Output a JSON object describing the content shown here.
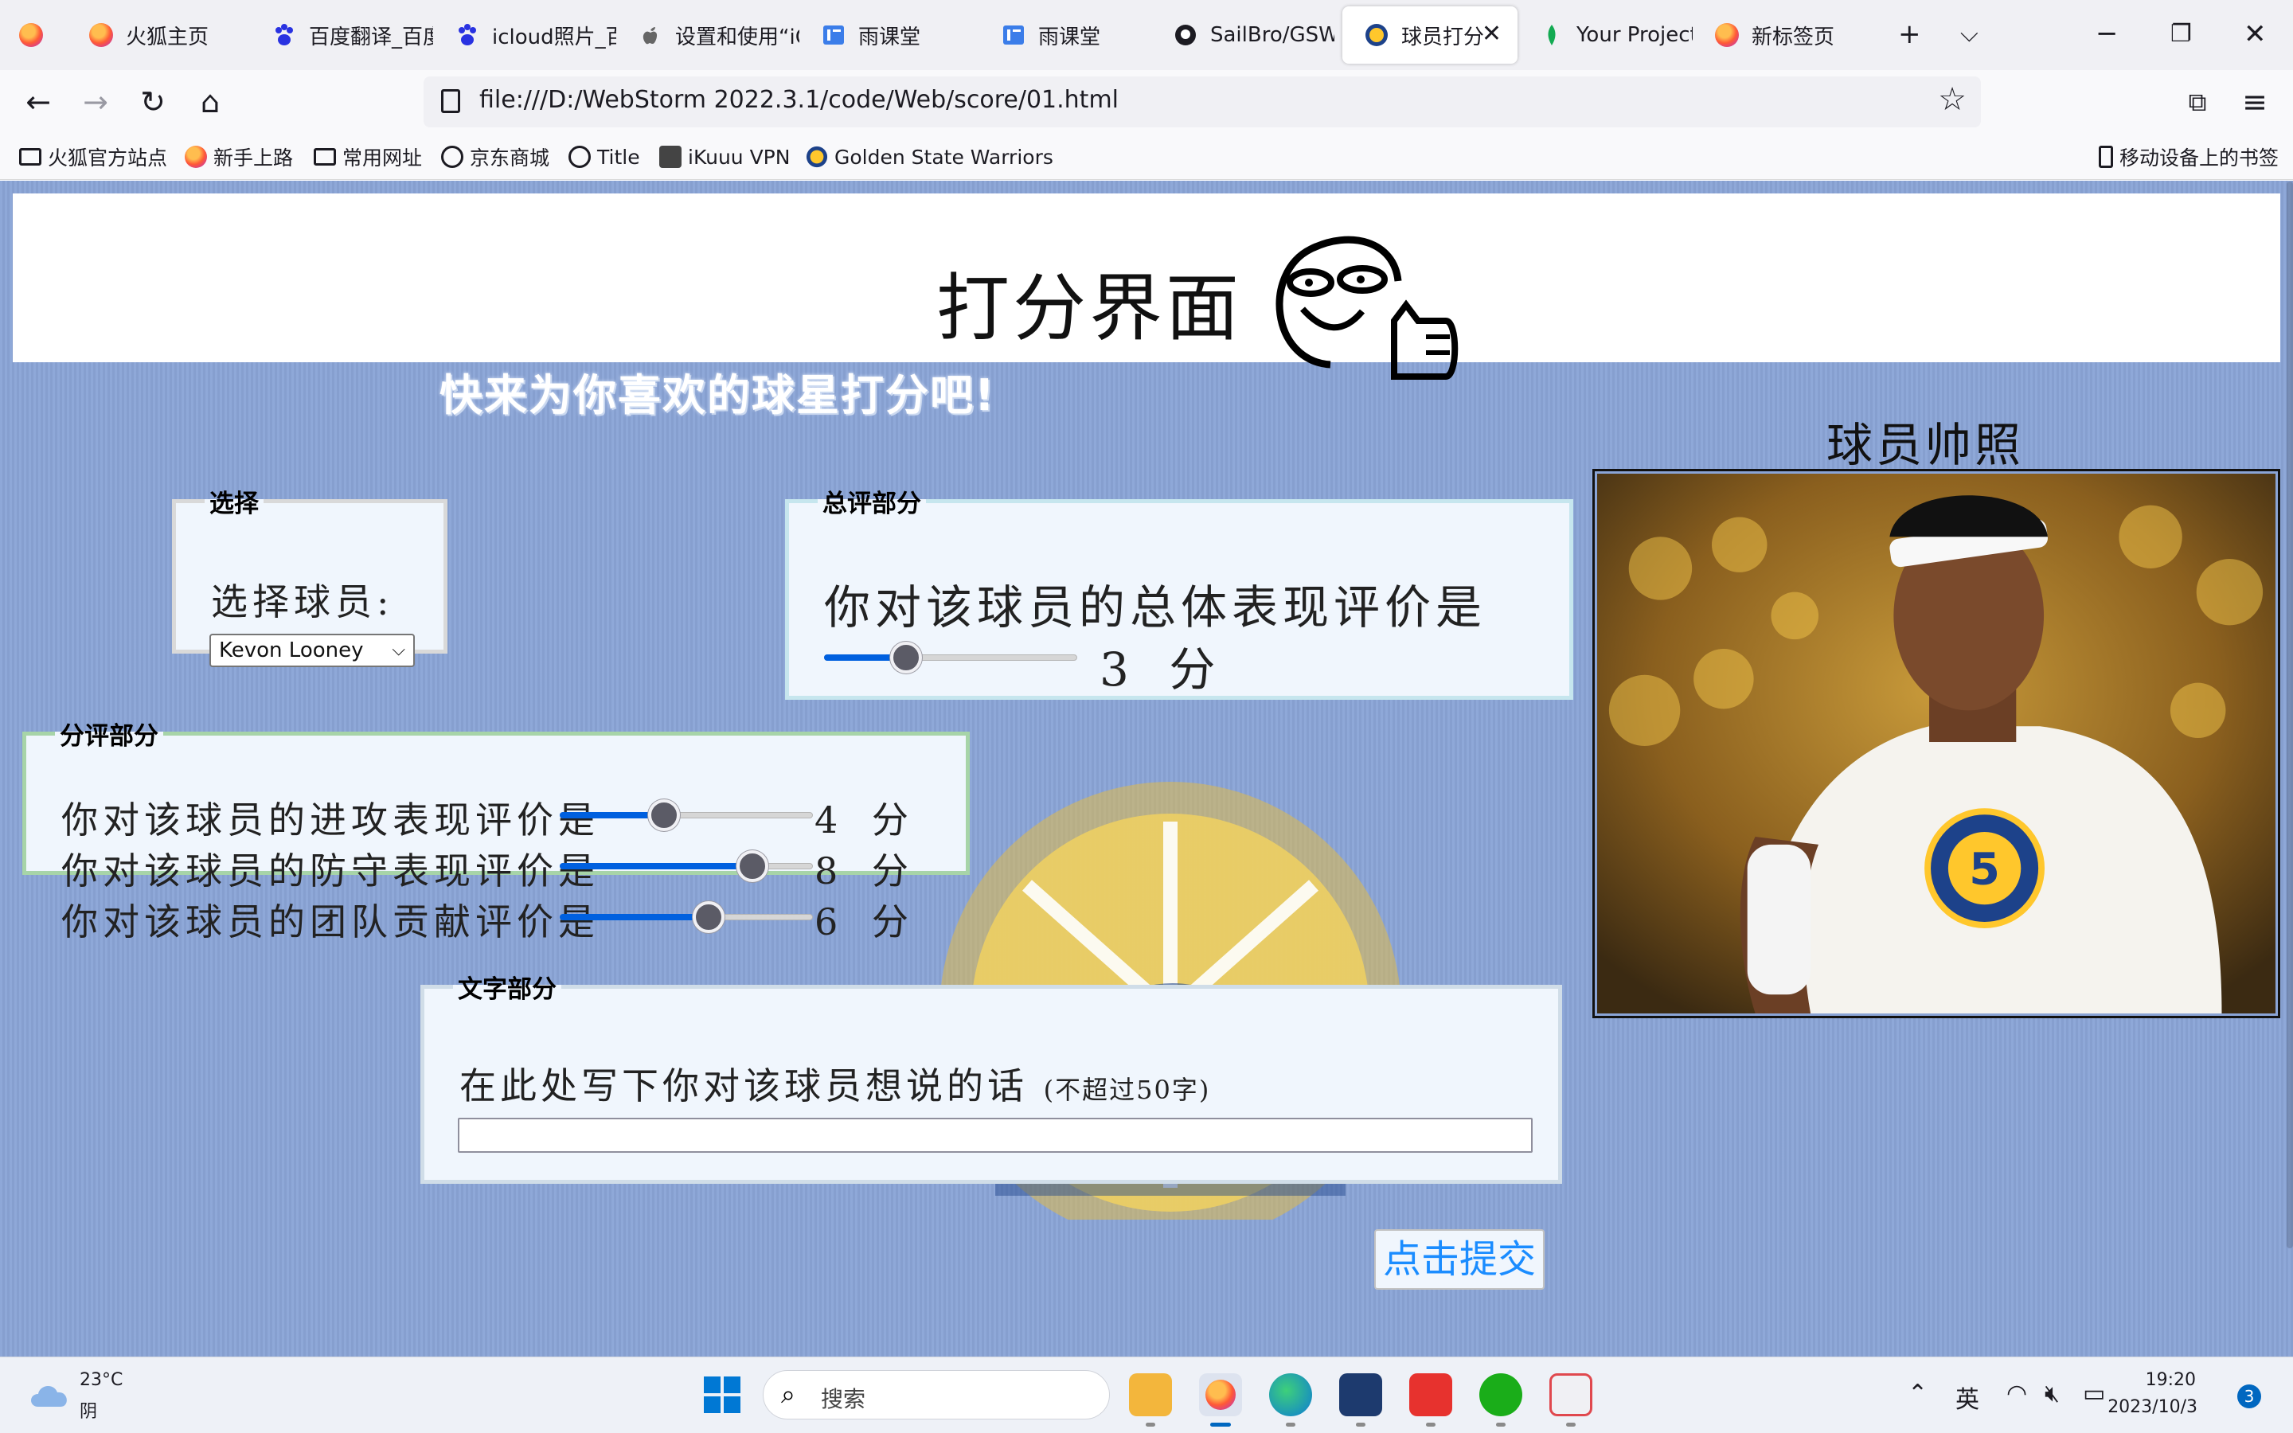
{
  "browser": {
    "tabs": [
      {
        "label": "火狐主页",
        "icon": "firefox-icon"
      },
      {
        "label": "百度翻译_百度",
        "icon": "baidu-paw-icon"
      },
      {
        "label": "icloud照片_百度",
        "icon": "baidu-paw-icon"
      },
      {
        "label": "设置和使用“iCloud",
        "icon": "apple-icon"
      },
      {
        "label": "雨课堂",
        "icon": "rain-classroom-icon"
      },
      {
        "label": "雨课堂",
        "icon": "rain-classroom-icon"
      },
      {
        "label": "SailBro/GSW",
        "icon": "github-icon"
      },
      {
        "label": "球员打分",
        "icon": "warriors-icon",
        "active": true
      },
      {
        "label": "Your Projects",
        "icon": "mongodb-leaf-icon"
      },
      {
        "label": "新标签页",
        "icon": "firefox-icon"
      }
    ],
    "url": "file:///D:/WebStorm 2022.3.1/code/Web/score/01.html",
    "bookmarks": [
      "火狐官方站点",
      "新手上路",
      "常用网址",
      "京东商城",
      "Title",
      "iKuuu VPN",
      "Golden State Warriors"
    ],
    "mobile_bookmarks": "移动设备上的书签"
  },
  "page": {
    "title": "打分界面",
    "slogan": "快来为你喜欢的球星打分吧!",
    "select_section": {
      "legend": "选择",
      "label": "选择球员:",
      "selected_player": "Kevon Looney"
    },
    "overall_section": {
      "legend": "总评部分",
      "text": "你对该球员的总体表现评价是",
      "score": 3,
      "score_text": "3 分",
      "min": 0,
      "max": 10
    },
    "partial_section": {
      "legend": "分评部分",
      "rows": [
        {
          "label": "你对该球员的进攻表现评价是",
          "score": 4,
          "score_text": "4 分"
        },
        {
          "label": "你对该球员的防守表现评价是",
          "score": 8,
          "score_text": "8 分"
        },
        {
          "label": "你对该球员的团队贡献评价是",
          "score": 6,
          "score_text": "6 分"
        }
      ],
      "min": 0,
      "max": 10
    },
    "text_section": {
      "legend": "文字部分",
      "prompt": "在此处写下你对该球员想说的话",
      "prompt_note": "(不超过50字)",
      "value": ""
    },
    "submit_label": "点击提交",
    "photo_title": "球员帅照",
    "jersey_number": "5"
  },
  "taskbar": {
    "weather_temp": "23°C",
    "weather_cond": "阴",
    "search_placeholder": "搜索",
    "ime": "英",
    "time": "19:20",
    "date": "2023/10/3",
    "notifications": "3"
  }
}
